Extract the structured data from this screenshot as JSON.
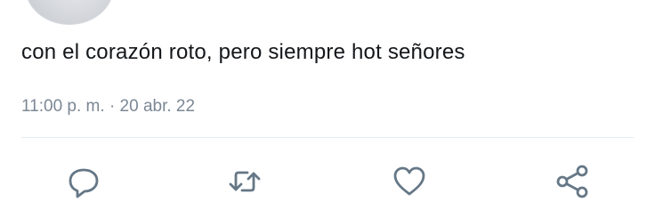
{
  "tweet": {
    "text": "con el corazón roto, pero siempre hot señores",
    "time": "11:00 p. m.",
    "separator": "·",
    "date": "20 abr. 22"
  },
  "actions": [
    {
      "icon": "reply-icon"
    },
    {
      "icon": "retweet-icon"
    },
    {
      "icon": "like-heart-icon"
    },
    {
      "icon": "share-icon"
    }
  ],
  "colors": {
    "text": "#14171a",
    "meta": "#7b8794",
    "icon": "#657786",
    "divider": "#e6ecf0"
  }
}
